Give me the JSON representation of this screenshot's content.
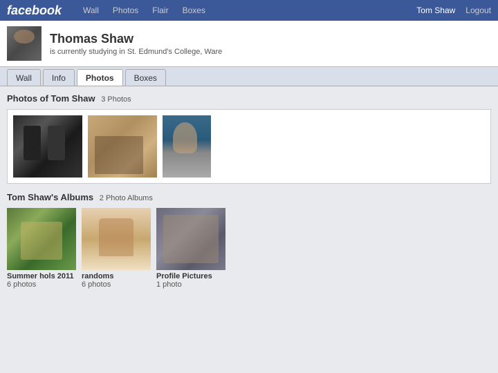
{
  "topbar": {
    "logo": "facebook",
    "nav": [
      {
        "label": "Wall",
        "id": "wall"
      },
      {
        "label": "Photos",
        "id": "photos"
      },
      {
        "label": "Flair",
        "id": "flair"
      },
      {
        "label": "Boxes",
        "id": "boxes"
      }
    ],
    "username": "Tom Shaw",
    "logout": "Logout"
  },
  "profile": {
    "name": "Thomas Shaw",
    "status": "is currently studying in St. Edmund's College, Ware"
  },
  "tabs": [
    {
      "label": "Wall",
      "id": "wall",
      "active": false
    },
    {
      "label": "Info",
      "id": "info",
      "active": false
    },
    {
      "label": "Photos",
      "id": "photos",
      "active": true
    },
    {
      "label": "Boxes",
      "id": "boxes",
      "active": false
    }
  ],
  "photos_section": {
    "title": "Photos of Tom Shaw",
    "count": "3 Photos"
  },
  "albums_section": {
    "title": "Tom Shaw's Albums",
    "count": "2 Photo Albums",
    "albums": [
      {
        "name": "Summer hols 2011",
        "count": "6 photos"
      },
      {
        "name": "randoms",
        "count": "6 photos"
      },
      {
        "name": "Profile Pictures",
        "count": "1 photo"
      }
    ]
  }
}
